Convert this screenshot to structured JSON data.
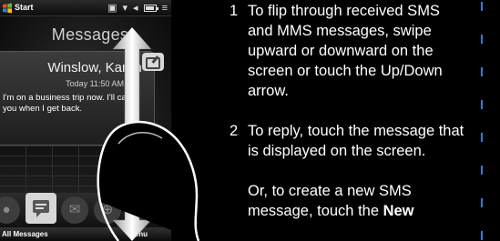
{
  "phone": {
    "status": {
      "start_label": "Start",
      "flag_icon": "windows-flag-icon"
    },
    "app_title": "Messages",
    "message": {
      "sender": "Winslow, Karen",
      "time": "Today 11:50 AM",
      "body": "I'm on a business trip now. I'll call you when I get back."
    },
    "tabs": [
      "people-icon",
      "messaging-icon",
      "mail-icon",
      "internet-icon",
      "camera-icon"
    ],
    "active_tab": "messaging-icon",
    "softkeys": {
      "left": "All Messages",
      "right": "Menu"
    }
  },
  "instructions": {
    "steps": [
      {
        "num": "1",
        "text": "To flip through received SMS and MMS messages, swipe upward or downward on the screen or  touch the Up/Down arrow."
      },
      {
        "num": "2",
        "text": "To reply, touch the message that is displayed on the screen."
      }
    ],
    "alt_prefix": "Or, to create a new SMS message, touch the ",
    "alt_bold": "New"
  },
  "colors": {
    "accent_dash": "#2f7fd6",
    "background": "#000000"
  }
}
